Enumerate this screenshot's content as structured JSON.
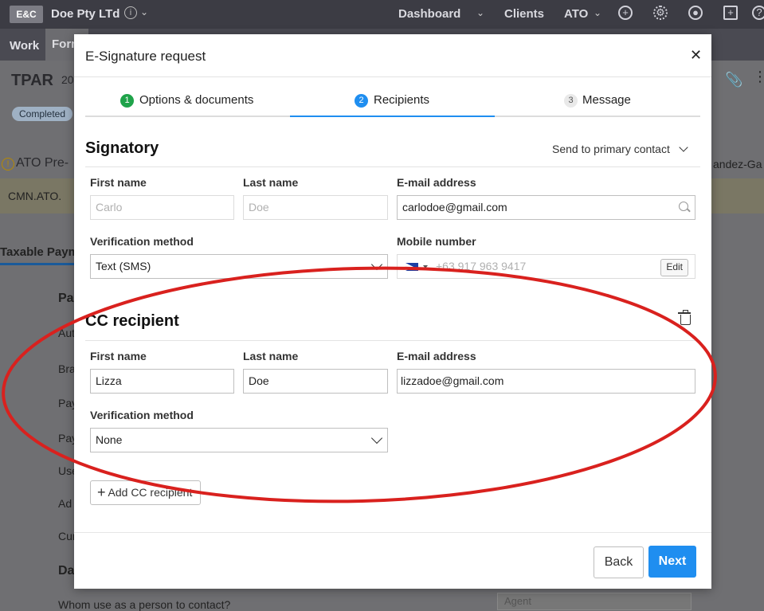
{
  "app": {
    "logo": "E&C",
    "company": "Doe Pty LTd",
    "nav": [
      "Dashboard",
      "Clients",
      "ATO"
    ],
    "subtabs": [
      "Work",
      "Form"
    ],
    "page_title": "TPAR",
    "page_title_suffix": "20",
    "status_badge": "Completed",
    "warning_text": "ATO Pre-",
    "warning_row": "CMN.ATO.",
    "right_trunc": "andez-Ga",
    "tab_label": "Taxable Paym",
    "bg_rows": [
      "Pa",
      "Aut",
      "Bra",
      "Pay",
      "Pay",
      "Use",
      "Ad",
      "Cur",
      "Da",
      "Whom use as a person to contact?"
    ],
    "bg_agent": "Agent"
  },
  "modal": {
    "title": "E-Signature request",
    "steps": [
      {
        "num": "1",
        "label": "Options & documents",
        "color": "#1fa34a"
      },
      {
        "num": "2",
        "label": "Recipients",
        "color": "#1f8ef0"
      },
      {
        "num": "3",
        "label": "Message",
        "color": "#e6e6e6"
      }
    ],
    "signatory": {
      "title": "Signatory",
      "send_to": "Send to primary contact",
      "first_name_label": "First name",
      "last_name_label": "Last name",
      "email_label": "E-mail address",
      "first_name": "Carlo",
      "last_name": "Doe",
      "email": "carlodoe@gmail.com",
      "verification_label": "Verification method",
      "verification": "Text (SMS)",
      "mobile_label": "Mobile number",
      "mobile_placeholder": "+63 917 963 9417",
      "edit": "Edit"
    },
    "cc": {
      "title": "CC recipient",
      "first_name_label": "First name",
      "last_name_label": "Last name",
      "email_label": "E-mail address",
      "first_name": "Lizza",
      "last_name": "Doe",
      "email": "lizzadoe@gmail.com",
      "verification_label": "Verification method",
      "verification": "None"
    },
    "add_cc": "Add CC recipient",
    "back": "Back",
    "next": "Next"
  },
  "colors": {
    "accent": "#1f8ef0",
    "annotation": "#d9211e"
  }
}
